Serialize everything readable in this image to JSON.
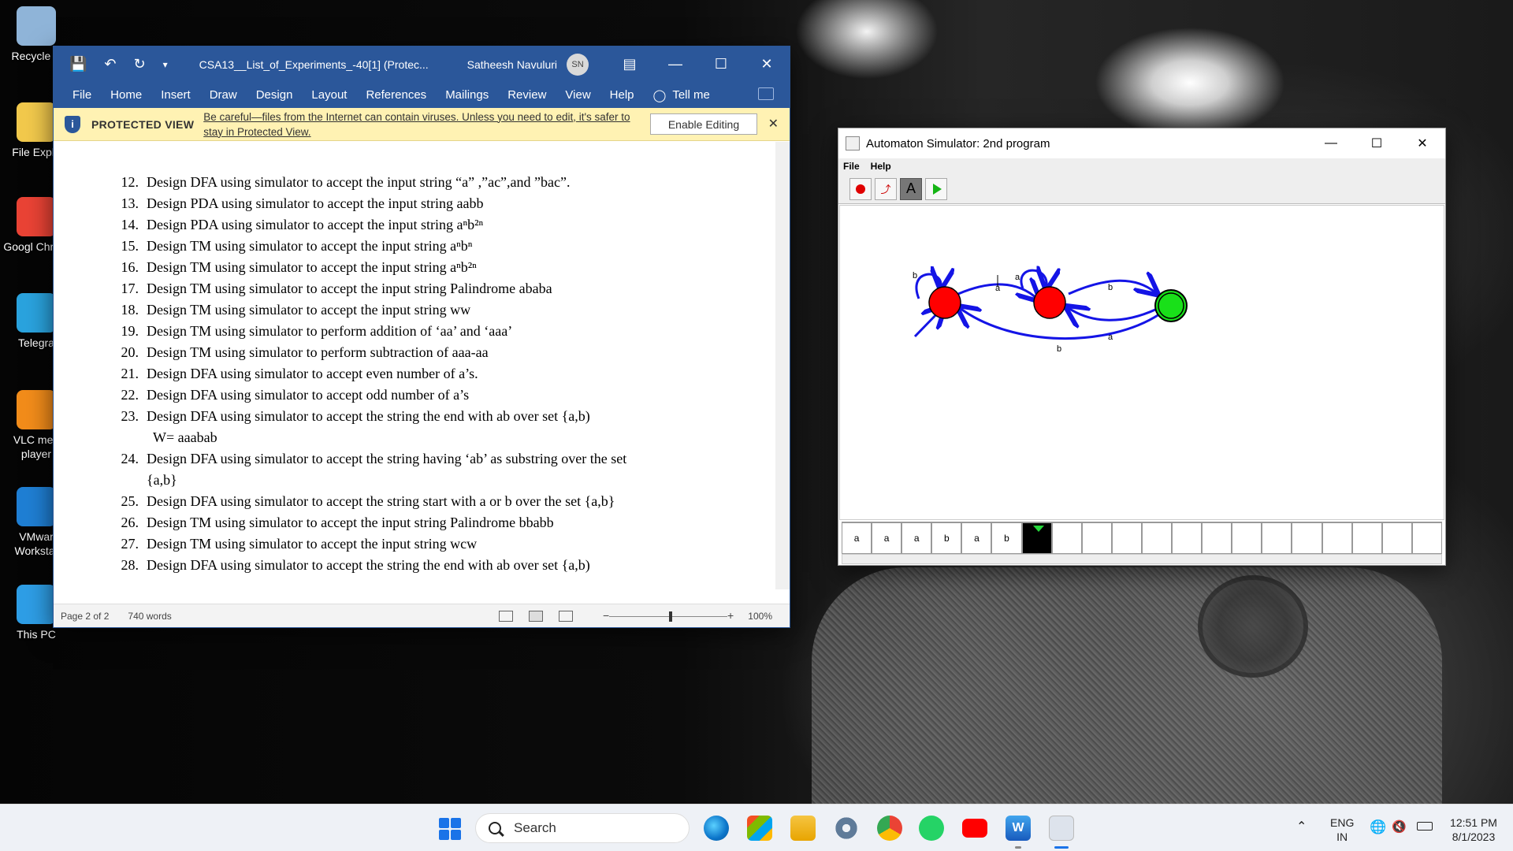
{
  "desktop": {
    "icons": [
      {
        "label": "Recycle B",
        "color": "#8fb4d8",
        "icon": "recycle-bin-icon"
      },
      {
        "label": "File Explo",
        "color": "#f2c94c",
        "icon": "folder-icon"
      },
      {
        "label": "Googl Chrom",
        "color": "#ea4335",
        "icon": "chrome-icon"
      },
      {
        "label": "Telegra",
        "color": "#2aa3de",
        "icon": "telegram-icon"
      },
      {
        "label": "VLC med player",
        "color": "#f28c1a",
        "icon": "vlc-icon"
      },
      {
        "label": "VMwar Workstat",
        "color": "#1f7fd4",
        "icon": "vmware-icon"
      },
      {
        "label": "This PC",
        "color": "#2e9ee6",
        "icon": "monitor-icon"
      }
    ]
  },
  "word": {
    "title": "CSA13__List_of_Experiments_-40[1] (Protec...",
    "user": "Satheesh Navuluri",
    "avatar": "SN",
    "ribbon": [
      "File",
      "Home",
      "Insert",
      "Draw",
      "Design",
      "Layout",
      "References",
      "Mailings",
      "Review",
      "View",
      "Help",
      "Tell me"
    ],
    "protected_label": "PROTECTED VIEW",
    "protected_message": "Be careful—files from the Internet can contain viruses. Unless you need to edit, it's safer to stay in Protected View.",
    "enable_editing": "Enable Editing",
    "items": [
      {
        "n": "12.",
        "text": "Design DFA  using simulator to accept the input string “a” ,”ac”,and ”bac”."
      },
      {
        "n": "13.",
        "text": "Design PDA using simulator to accept the input string aabb"
      },
      {
        "n": "14.",
        "text": "Design PDA using simulator to accept the input string  aⁿb²ⁿ"
      },
      {
        "n": "15.",
        "text": "Design TM using simulator to accept the input string aⁿbⁿ"
      },
      {
        "n": "16.",
        "text": "Design TM using simulator to accept the input string aⁿb²ⁿ"
      },
      {
        "n": "17.",
        "text": "Design TM using simulator to accept the input string Palindrome  ababa"
      },
      {
        "n": "18.",
        "text": "Design TM using simulator to accept the input string  ww"
      },
      {
        "n": "19.",
        "text": "Design TM using simulator to perform addition of ‘aa’ and ‘aaa’"
      },
      {
        "n": "20.",
        "text": "Design TM using simulator to perform subtraction of aaa-aa"
      },
      {
        "n": "21.",
        "text": "Design DFA  using simulator to  accept even number of a’s."
      },
      {
        "n": "22.",
        "text": "Design DFA using simulator to accept odd number of a’s"
      },
      {
        "n": "23.",
        "text": "Design DFA using simulator to accept the string the end with ab over set {a,b)"
      },
      {
        "n": "",
        "text": "W=  aaabab"
      },
      {
        "n": "24.",
        "text": "Design DFA using simulator to accept the string having ‘ab’ as substring over the set"
      },
      {
        "n": "",
        "text": "{a,b}"
      },
      {
        "n": "25.",
        "text": "Design DFA using simulator to accept the string start with a or b over the set {a,b}"
      },
      {
        "n": "26.",
        "text": "Design TM using simulator to accept the input string Palindrome  bbabb"
      },
      {
        "n": "27.",
        "text": "Design TM using simulator to accept the input string  wcw"
      },
      {
        "n": "28.",
        "text": "Design DFA using simulator to accept the string the end with ab over set {a,b)"
      }
    ],
    "status": {
      "page": "Page 2 of 2",
      "words": "740 words",
      "zoom": "100%"
    }
  },
  "jflap": {
    "title": "Automaton Simulator: 2nd program",
    "menu": [
      "File",
      "Help"
    ],
    "edge_labels": {
      "q0_loop": "b",
      "q0_to_q1": "a",
      "q1_loop": "a",
      "q1_to_q2": "b",
      "q2_to_q1": "a",
      "q2_to_q0": "b"
    },
    "state_colors": {
      "normal": "#ff0000",
      "final": "#19e019",
      "edge": "#1414e6"
    },
    "tape": [
      "a",
      "a",
      "a",
      "b",
      "a",
      "b",
      "",
      "",
      "",
      "",
      "",
      "",
      "",
      "",
      "",
      "",
      "",
      "",
      "",
      ""
    ],
    "head_index": 6
  },
  "taskbar": {
    "search": "Search",
    "lang_top": "ENG",
    "lang_bottom": "IN",
    "time": "12:51 PM",
    "date": "8/1/2023"
  }
}
